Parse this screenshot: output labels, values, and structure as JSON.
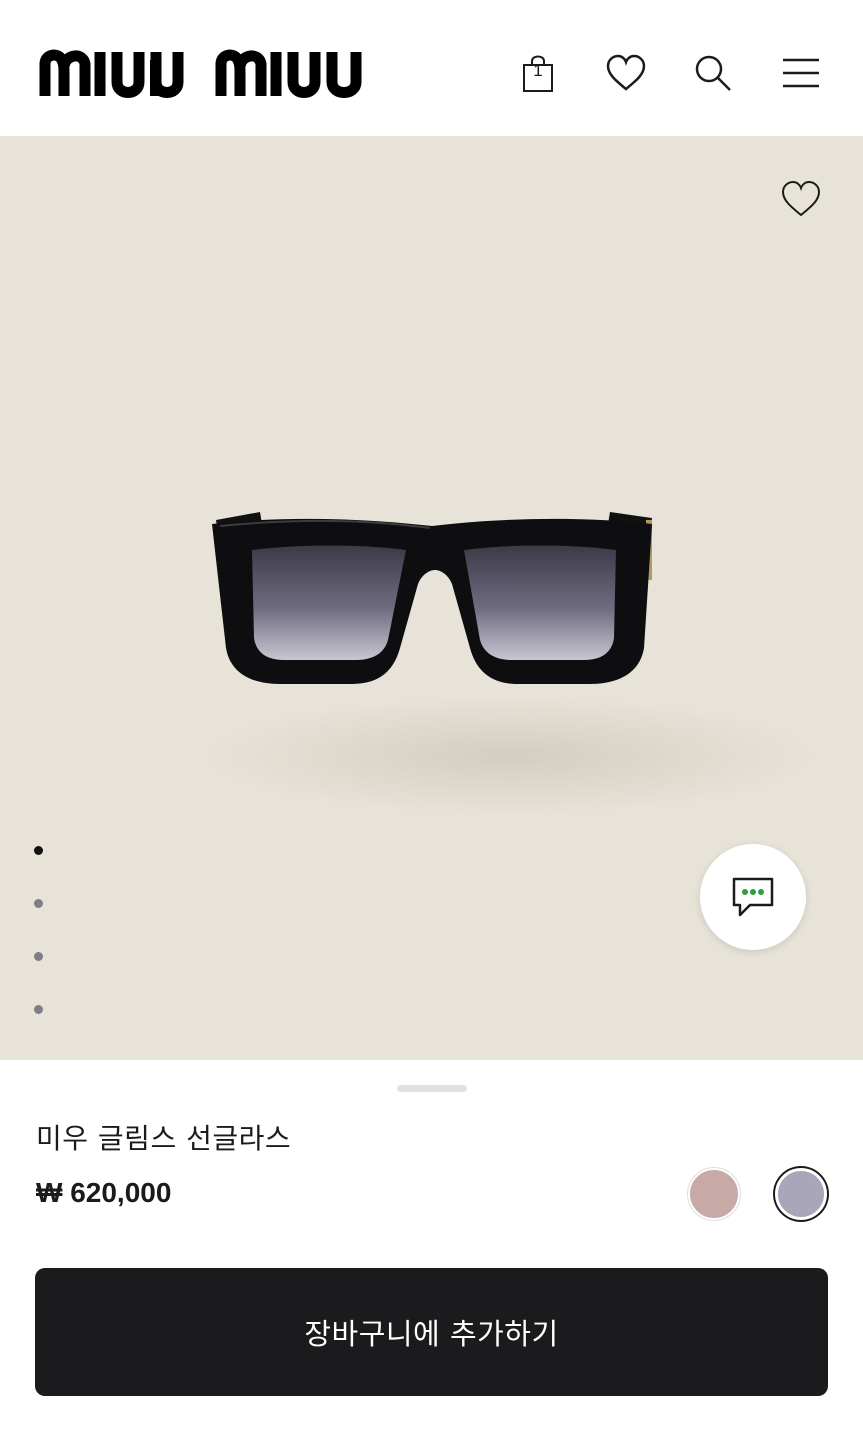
{
  "header": {
    "logo_text": "miu miu",
    "bag_count": "1",
    "icons": [
      "shopping-bag-icon",
      "heart-icon",
      "search-icon",
      "hamburger-menu-icon"
    ]
  },
  "gallery": {
    "image_subject": "sunglasses",
    "slide_count": 4,
    "active_slide": 1,
    "icons": [
      "heart-icon",
      "chat-icon"
    ]
  },
  "product": {
    "name": "미우 글림스 선글라스",
    "price": "₩ 620,000"
  },
  "colors": {
    "swatches": [
      "#c7a9a7",
      "#a8a6b8"
    ],
    "selected_index": 1,
    "background": "#e7e3d8",
    "button": "#1b1b1d"
  },
  "cta": {
    "label": "장바구니에 추가하기"
  }
}
